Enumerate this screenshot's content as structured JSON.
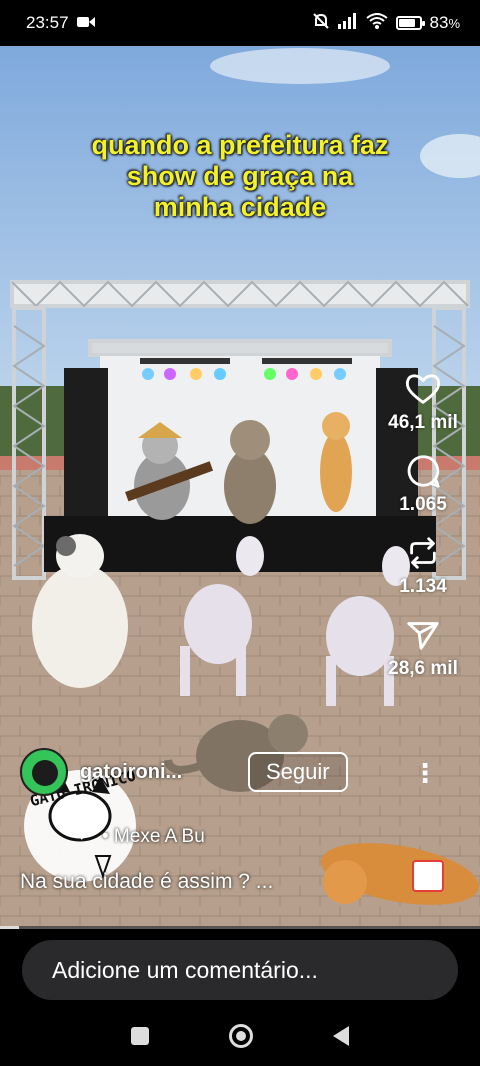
{
  "status": {
    "time": "23:57",
    "battery": "83",
    "battery_suffix": "%",
    "icons": [
      "video-camera-icon",
      "mute-bell-icon",
      "signal-icon",
      "wifi-icon",
      "battery-icon"
    ]
  },
  "video": {
    "caption_lines": [
      "quando a prefeitura faz",
      "show de graça na",
      "minha cidade"
    ],
    "watermark": "GATO IRÔNICO",
    "progress": 0.04
  },
  "actions": {
    "likes": "46,1 mil",
    "comments": "1.065",
    "reposts": "1.134",
    "shares": "28,6 mil"
  },
  "author": {
    "username": "gatoironi...",
    "follow_label": "Seguir"
  },
  "music": {
    "text": "• Mexe A Bu"
  },
  "description": "Na sua cidade é assim ? ...",
  "comment_placeholder": "Adicione um comentário...",
  "colors": {
    "caption": "#f3f12c",
    "sky": "#9cc3ea",
    "ground": "#b9a594"
  }
}
